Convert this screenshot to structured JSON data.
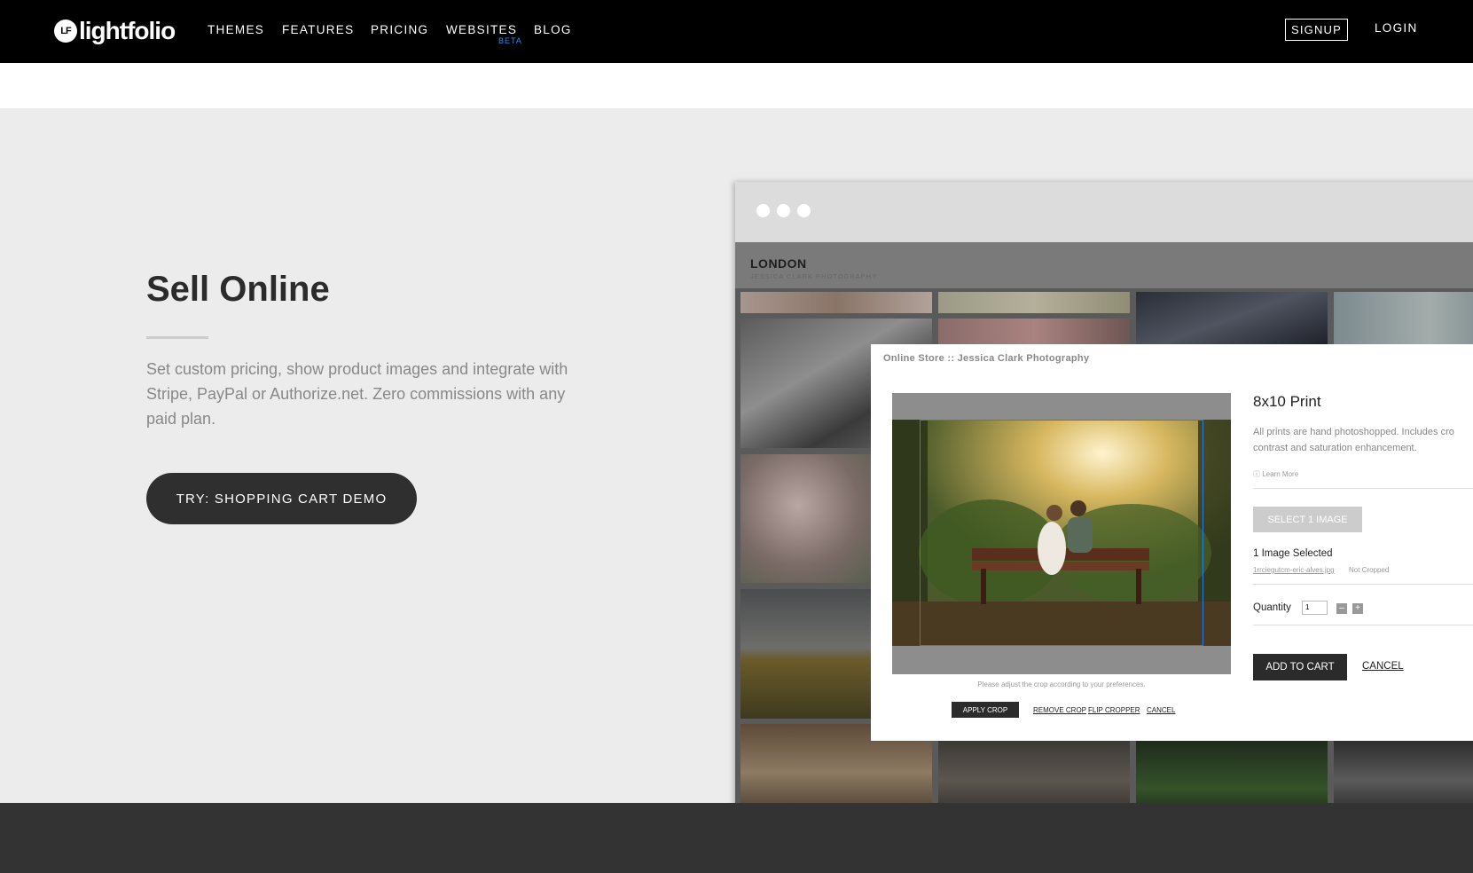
{
  "nav": {
    "logo_badge": "LF",
    "logo_text": "lightfolio",
    "items": [
      "THEMES",
      "FEATURES",
      "PRICING",
      "WEBSITES",
      "BLOG"
    ],
    "beta_badge": "BETA",
    "signup": "SIGNUP",
    "login": "LOGIN"
  },
  "hero": {
    "title": "Sell Online",
    "description": "Set custom pricing, show product images and integrate with Stripe, PayPal or Authorize.net. Zero commissions with any paid plan.",
    "cta": "TRY: SHOPPING CART DEMO"
  },
  "mock": {
    "site_title": "LONDON",
    "site_subtitle": "JESSICA CLARK PHOTOGRAPHY",
    "modal": {
      "title": "Online Store :: Jessica Clark Photography",
      "crop_hint": "Please adjust the crop according to your preferences.",
      "apply_crop": "APPLY CROP",
      "remove_crop": "REMOVE CROP",
      "flip_cropper": "FLIP CROPPER",
      "crop_cancel": "CANCEL",
      "product_title": "8x10 Print",
      "product_desc_1": "All prints are hand photoshopped. Includes cro",
      "product_desc_2": "contrast and saturation enhancement.",
      "learn_more": "Learn More",
      "select_button": "SELECT 1 IMAGE",
      "images_selected": "1 Image Selected",
      "file_name": "1rrciegutcm-eric-alves.jpg",
      "crop_status": "Not Cropped",
      "quantity_label": "Quantity",
      "quantity_value": "1",
      "minus": "–",
      "plus": "+",
      "add_to_cart": "ADD TO CART",
      "cancel": "CANCEL"
    }
  },
  "colors": {
    "nav_bg": "#000000",
    "hero_bg": "#ececec",
    "button_dark": "#2f2f2f",
    "beta_blue": "#2c8fe6",
    "footer_bg": "#333333"
  }
}
